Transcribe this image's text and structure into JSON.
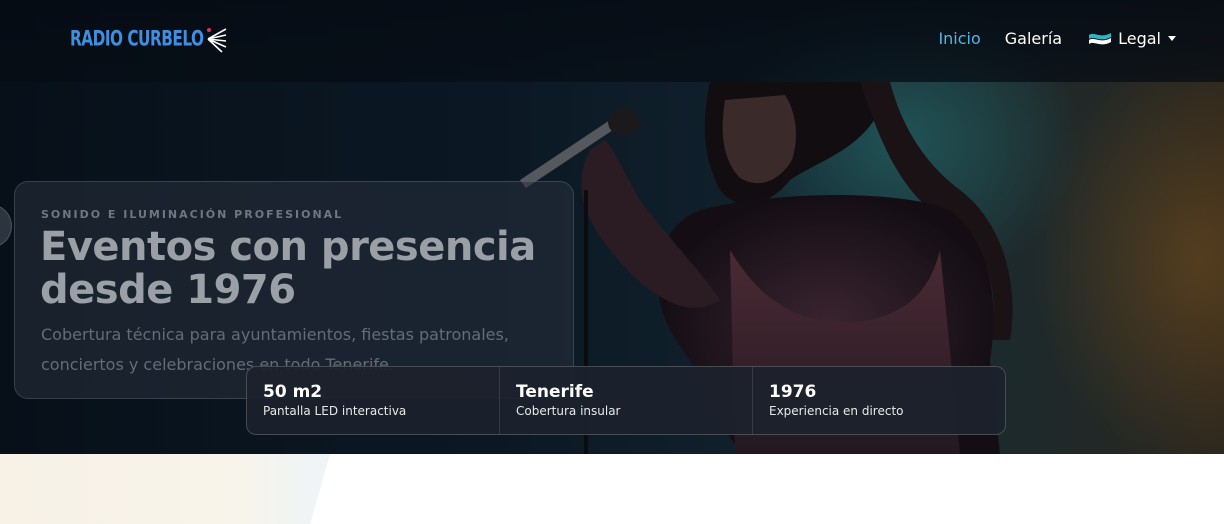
{
  "brand": {
    "logo_text": "RADIO CURBELO"
  },
  "nav": {
    "items": [
      {
        "label": "Inicio",
        "active": true
      },
      {
        "label": "Galería",
        "active": false
      }
    ],
    "legal_label": "Legal",
    "legal_flag_icon": "legal-wave-icon"
  },
  "hero": {
    "eyebrow": "SONIDO E ILUMINACIÓN PROFESIONAL",
    "title": "Eventos con presencia desde 1976",
    "subtitle": "Cobertura técnica para ayuntamientos, fiestas patronales, conciertos y celebraciones en todo Tenerife."
  },
  "stats": [
    {
      "value": "50 m2",
      "label": "Pantalla LED interactiva"
    },
    {
      "value": "Tenerife",
      "label": "Cobertura insular"
    },
    {
      "value": "1976",
      "label": "Experiencia en directo"
    }
  ],
  "colors": {
    "accent": "#4fb6e8",
    "logo_blue": "#3f8fe0",
    "hero_bg": "#0b1824"
  }
}
